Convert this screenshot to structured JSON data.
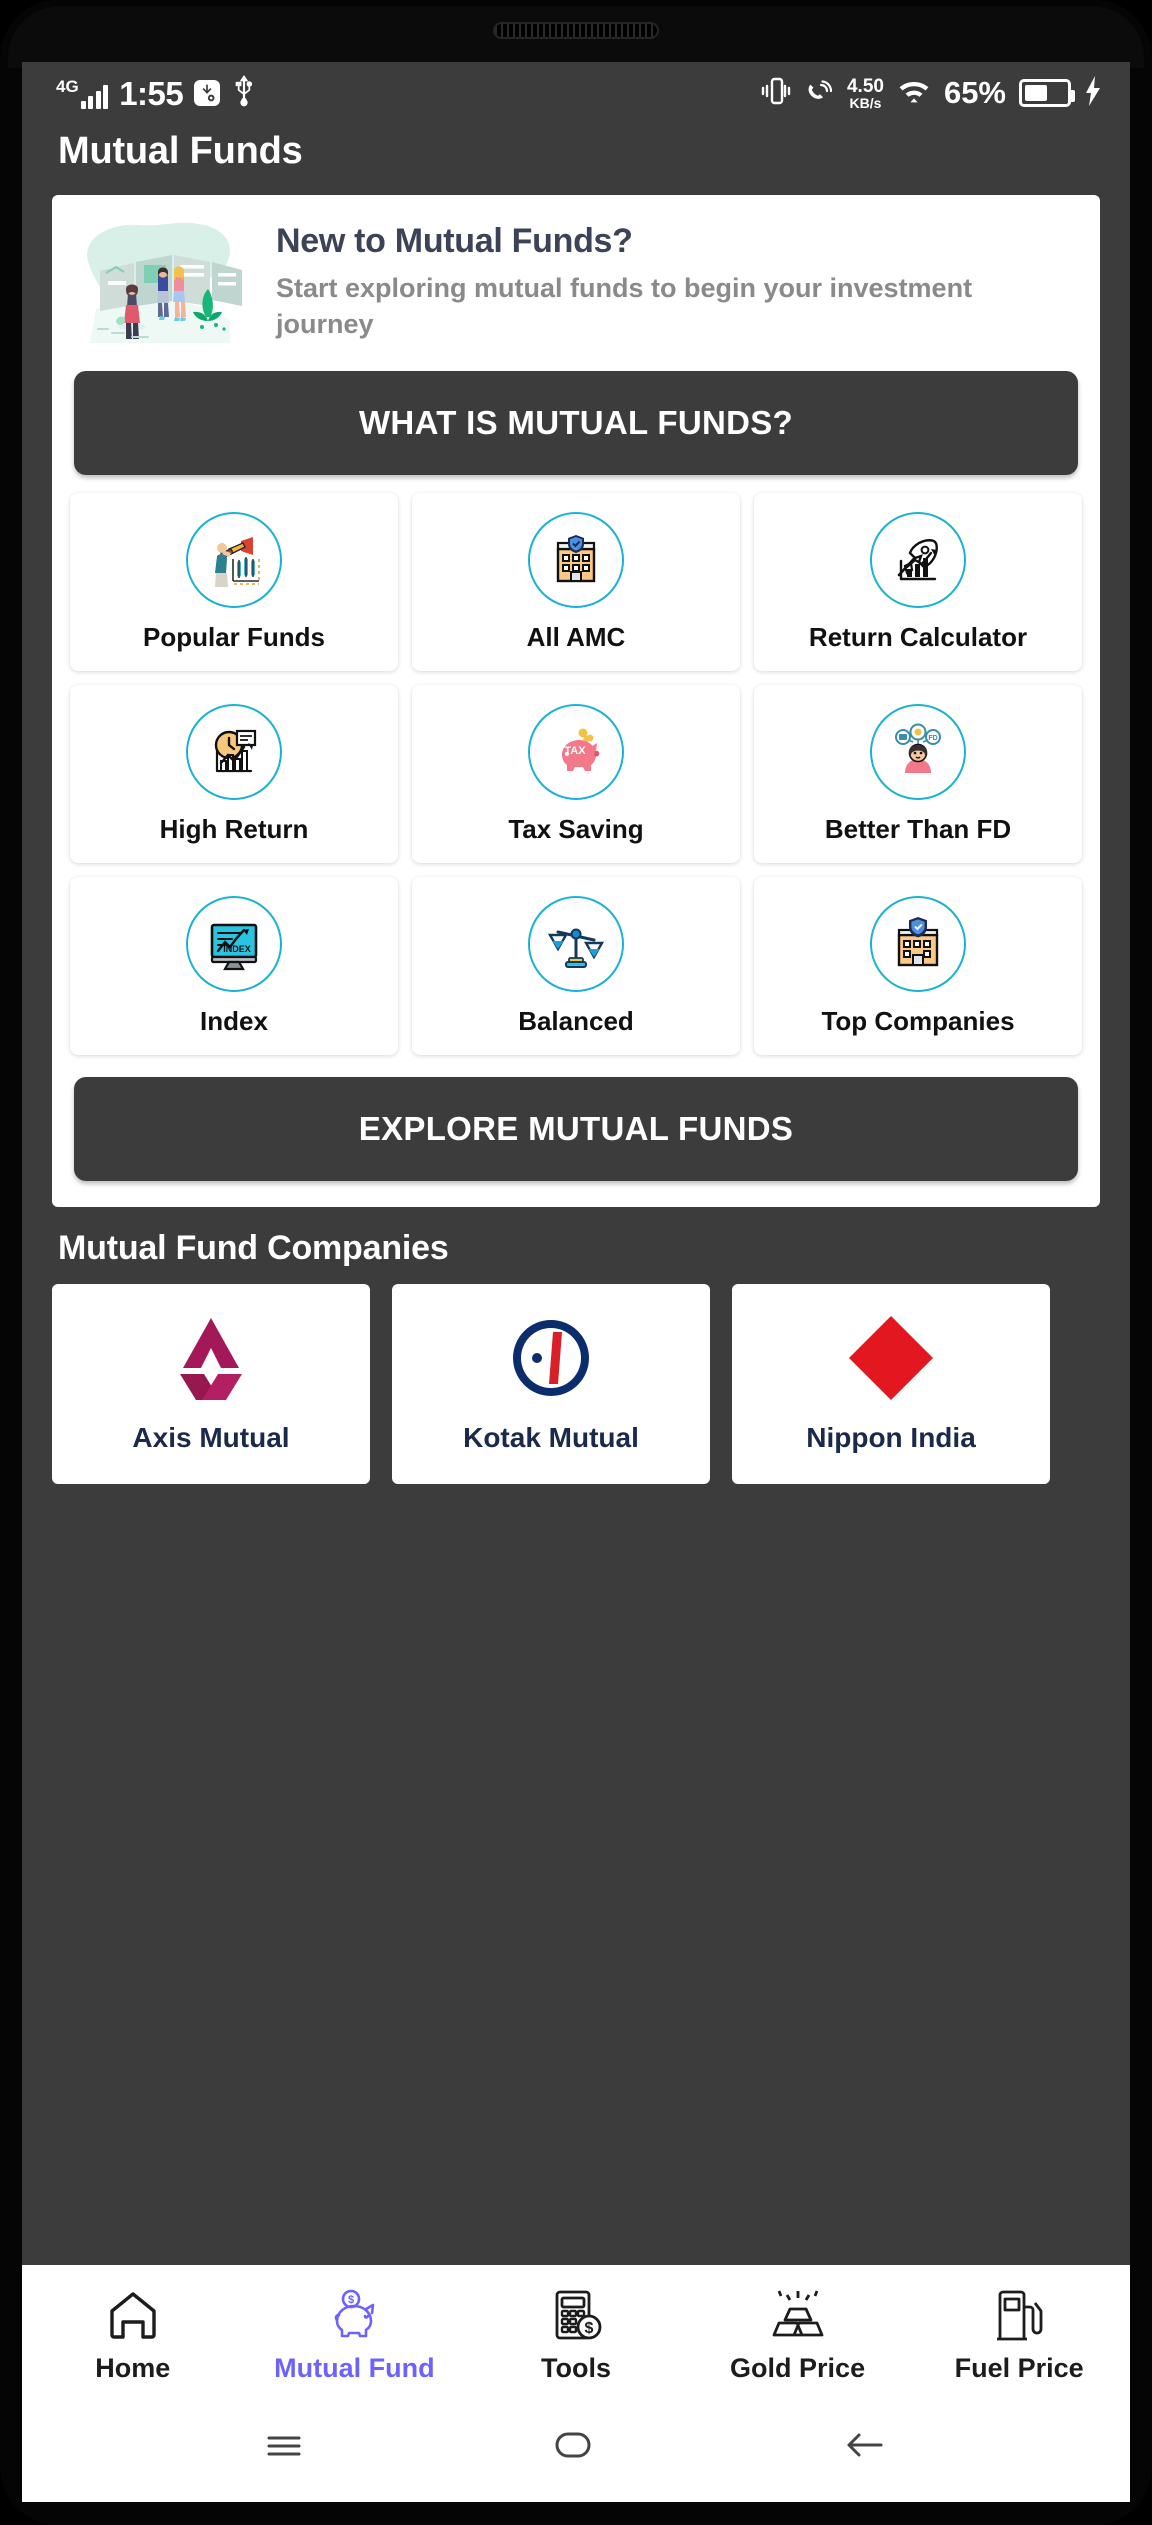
{
  "status_bar": {
    "network_type": "4G",
    "time": "1:55",
    "usb_debug_icon": "usb-debugging-icon",
    "usb_icon": "usb-icon",
    "vibrate_icon": "vibrate-icon",
    "call_wifi_icon": "wifi-calling-icon",
    "data_rate_value": "4.50",
    "data_rate_unit": "KB/s",
    "wifi_icon": "wifi-icon",
    "battery_percent": "65%",
    "battery_icon": "battery-icon",
    "charging_icon": "charging-bolt-icon"
  },
  "app_bar": {
    "title": "Mutual Funds"
  },
  "banner": {
    "illustration": "gallery-visitors-illustration",
    "heading": "New to Mutual Funds?",
    "subtext": "Start exploring mutual funds to begin your investment journey",
    "cta_label": "WHAT IS MUTUAL FUNDS?"
  },
  "tiles": [
    {
      "label": "Popular Funds",
      "icon": "telescope-chart-icon"
    },
    {
      "label": "All AMC",
      "icon": "building-shield-icon"
    },
    {
      "label": "Return Calculator",
      "icon": "rocket-growth-icon"
    },
    {
      "label": "High Return",
      "icon": "clock-bar-chart-icon"
    },
    {
      "label": "Tax Saving",
      "icon": "tax-piggy-bank-icon"
    },
    {
      "label": "Better Than FD",
      "icon": "advisor-person-icon"
    },
    {
      "label": "Index",
      "icon": "index-monitor-icon"
    },
    {
      "label": "Balanced",
      "icon": "balance-scales-icon"
    },
    {
      "label": "Top Companies",
      "icon": "company-shield-icon"
    }
  ],
  "explore_button": {
    "label": "EXPLORE MUTUAL FUNDS"
  },
  "companies_section": {
    "title": "Mutual Fund Companies",
    "items": [
      {
        "name": "Axis Mutual",
        "logo": "axis-logo"
      },
      {
        "name": "Kotak Mutual",
        "logo": "kotak-logo"
      },
      {
        "name": "Nippon India",
        "logo": "nippon-logo"
      }
    ]
  },
  "bottom_nav": {
    "active_color": "#6c63ff",
    "items": [
      {
        "label": "Home",
        "icon": "home-icon",
        "active": false
      },
      {
        "label": "Mutual Fund",
        "icon": "piggy-bank-icon",
        "active": true
      },
      {
        "label": "Tools",
        "icon": "calculator-icon",
        "active": false
      },
      {
        "label": "Gold Price",
        "icon": "gold-bars-icon",
        "active": false
      },
      {
        "label": "Fuel Price",
        "icon": "fuel-pump-icon",
        "active": false
      }
    ]
  },
  "system_nav": {
    "recents": "recents-icon",
    "home": "home-pill-icon",
    "back": "back-arrow-icon"
  },
  "theme": {
    "app_background": "#3c3c3c",
    "card_background": "#ffffff",
    "accent_ring": "#1ab2d2",
    "nav_active": "#6c63ff"
  }
}
